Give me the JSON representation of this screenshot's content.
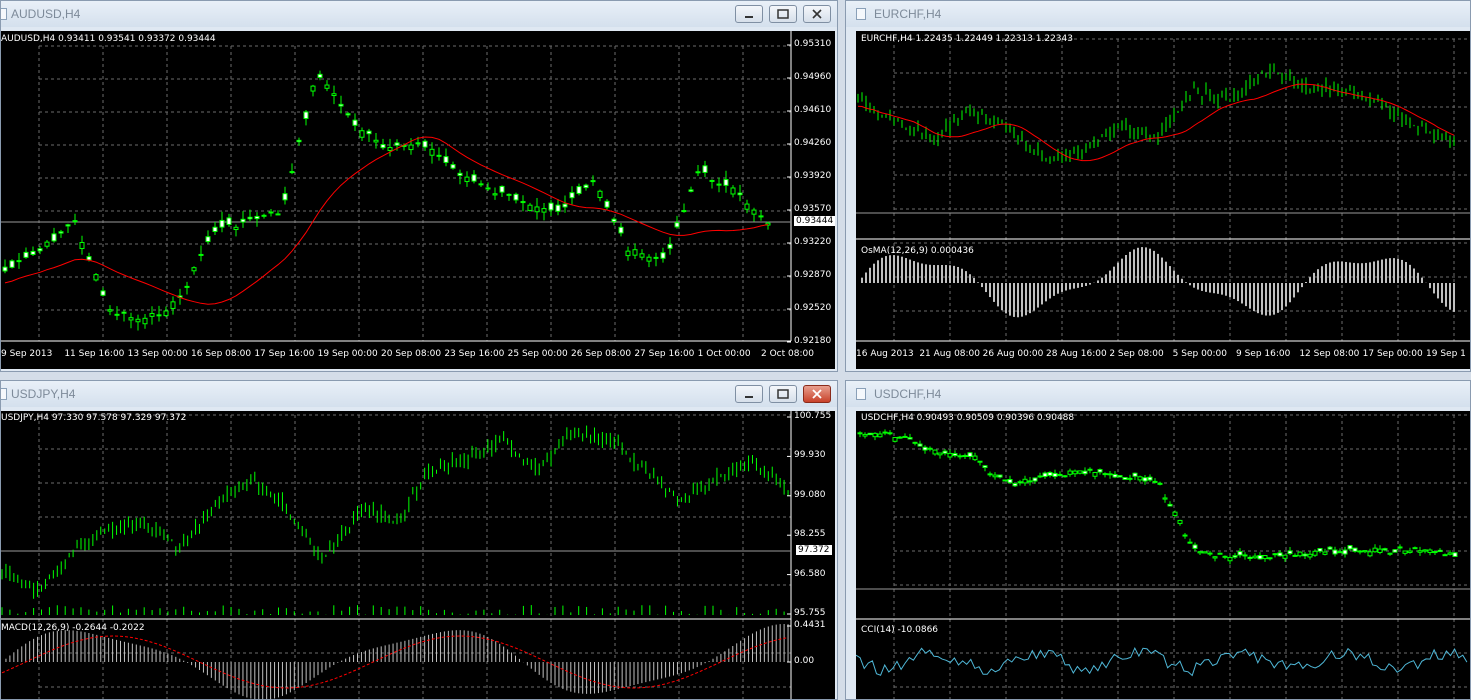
{
  "windows": {
    "audusd": {
      "title": "AUDUSD,H4",
      "info": "AUDUSD,H4  0.93411 0.93541 0.93372 0.93444",
      "current_price": "0.93444",
      "price_ticks": [
        "0.95310",
        "0.94960",
        "0.94610",
        "0.94260",
        "0.93920",
        "0.93570",
        "0.93220",
        "0.92870",
        "0.92520",
        "0.92180"
      ],
      "time_ticks": [
        "9 Sep 2013",
        "11 Sep 16:00",
        "13 Sep 00:00",
        "16 Sep 08:00",
        "17 Sep 16:00",
        "19 Sep 00:00",
        "20 Sep 08:00",
        "23 Sep 16:00",
        "25 Sep 00:00",
        "26 Sep 08:00",
        "27 Sep 16:00",
        "1 Oct 00:00",
        "2 Oct 08:00"
      ],
      "colors": {
        "bull": "#ffffff",
        "bear": "#000000",
        "wick": "#00ff00",
        "ma": "#ff0000"
      }
    },
    "eurchf": {
      "title": "EURCHF,H4",
      "info": "EURCHF,H4  1.22435 1.22449 1.22313 1.22343",
      "osma_label": "OsMA(12,26,9) 0.000436",
      "time_ticks": [
        "16 Aug 2013",
        "21 Aug 08:00",
        "26 Aug 00:00",
        "28 Aug 16:00",
        "2 Sep 08:00",
        "5 Sep 00:00",
        "9 Sep 16:00",
        "12 Sep 08:00",
        "17 Sep 00:00",
        "19 Sep 1"
      ]
    },
    "usdjpy": {
      "title": "USDJPY,H4",
      "info": "USDJPY,H4  97.330 97.578 97.329 97.372",
      "current_price": "97.372",
      "price_ticks": [
        "100.755",
        "99.930",
        "99.080",
        "98.255",
        "96.580",
        "95.755"
      ],
      "macd_label": "MACD(12,26,9) -0.2644 -0.2022",
      "macd_ticks": [
        "0.4431",
        "0.00"
      ]
    },
    "usdchf": {
      "title": "USDCHF,H4",
      "info": "USDCHF,H4  0.90493 0.90509 0.90396 0.90488",
      "cci_label": "CCI(14) -10.0866"
    }
  }
}
